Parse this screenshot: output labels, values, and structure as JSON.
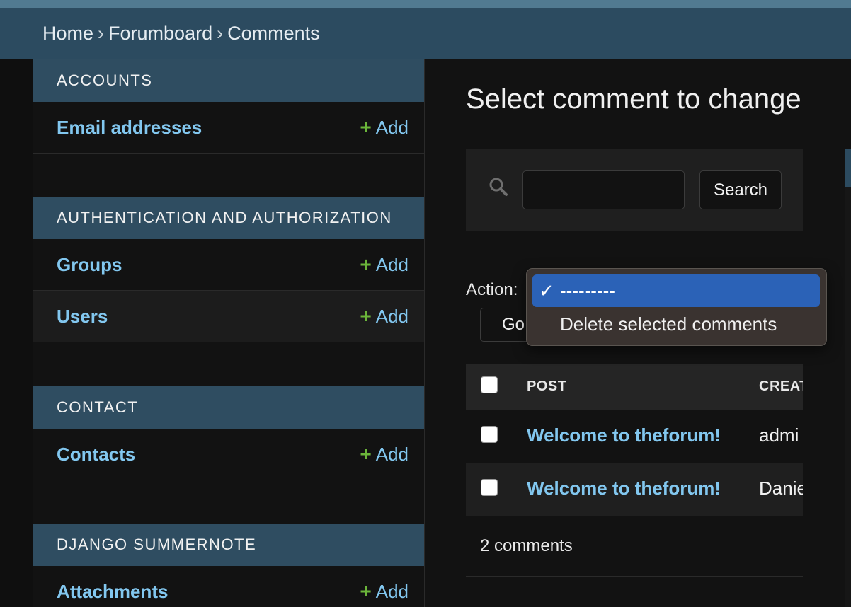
{
  "breadcrumbs": {
    "items": [
      "Home",
      "Forumboard",
      "Comments"
    ],
    "separator": "›"
  },
  "sidebar": {
    "add_label": "Add",
    "modules": [
      {
        "title": "ACCOUNTS",
        "models": [
          {
            "label": "Email addresses"
          }
        ]
      },
      {
        "title": "AUTHENTICATION AND AUTHORIZATION",
        "models": [
          {
            "label": "Groups"
          },
          {
            "label": "Users"
          }
        ]
      },
      {
        "title": "CONTACT",
        "models": [
          {
            "label": "Contacts"
          }
        ]
      },
      {
        "title": "DJANGO SUMMERNOTE",
        "models": [
          {
            "label": "Attachments"
          }
        ]
      }
    ]
  },
  "main": {
    "title": "Select comment to change",
    "search": {
      "value": "",
      "button_label": "Search"
    },
    "actions": {
      "label": "Action:",
      "go_label": "Go",
      "options": [
        {
          "label": "---------",
          "selected": true
        },
        {
          "label": "Delete selected comments",
          "selected": false
        }
      ]
    },
    "table": {
      "columns": [
        "POST",
        "CREAT"
      ],
      "rows": [
        {
          "post": "Welcome to theforum!",
          "created": "admi"
        },
        {
          "post": "Welcome to theforum!",
          "created": "Danie"
        }
      ]
    },
    "result_count": "2 comments"
  },
  "colors": {
    "header": "#2c4b60",
    "module_header": "#2f4d61",
    "link": "#82c7ef",
    "add_plus": "#6bb53a",
    "selected_option": "#2b62b7"
  },
  "icons": {
    "search": "search-icon",
    "add": "plus-icon",
    "check": "checkmark-icon"
  }
}
